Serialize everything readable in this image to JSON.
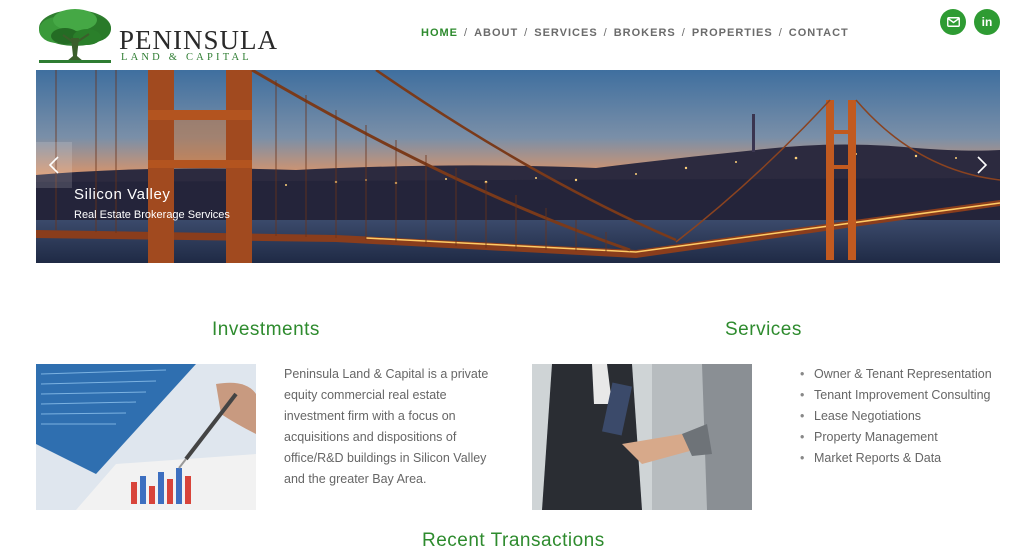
{
  "brand": {
    "name": "PENINSULA",
    "tagline": "LAND & CAPITAL"
  },
  "nav": {
    "items": [
      {
        "label": "HOME",
        "active": true
      },
      {
        "label": "ABOUT",
        "active": false
      },
      {
        "label": "SERVICES",
        "active": false
      },
      {
        "label": "BROKERS",
        "active": false
      },
      {
        "label": "PROPERTIES",
        "active": false
      },
      {
        "label": "CONTACT",
        "active": false
      }
    ],
    "separator": "/"
  },
  "social": {
    "icons": [
      "mail-icon",
      "linkedin-icon"
    ],
    "linkedin_label": "in"
  },
  "hero": {
    "title": "Silicon Valley",
    "subtitle": "Real Estate Brokerage Services",
    "prev_icon": "chevron-left-icon",
    "next_icon": "chevron-right-icon"
  },
  "investments": {
    "title": "Investments",
    "body": "Peninsula Land & Capital is a private equity commercial real estate investment firm with a focus on acquisitions and dispositions of office/R&D buildings in Silicon Valley and the greater Bay Area."
  },
  "services": {
    "title": "Services",
    "items": [
      "Owner & Tenant Representation",
      "Tenant Improvement Consulting",
      "Lease Negotiations",
      "Property Management",
      "Market Reports & Data"
    ]
  },
  "recent": {
    "title": "Recent Transactions"
  },
  "colors": {
    "brand_green": "#2e8b2e",
    "social_green": "#2e9b33",
    "nav_gray": "#6b6b6b"
  }
}
